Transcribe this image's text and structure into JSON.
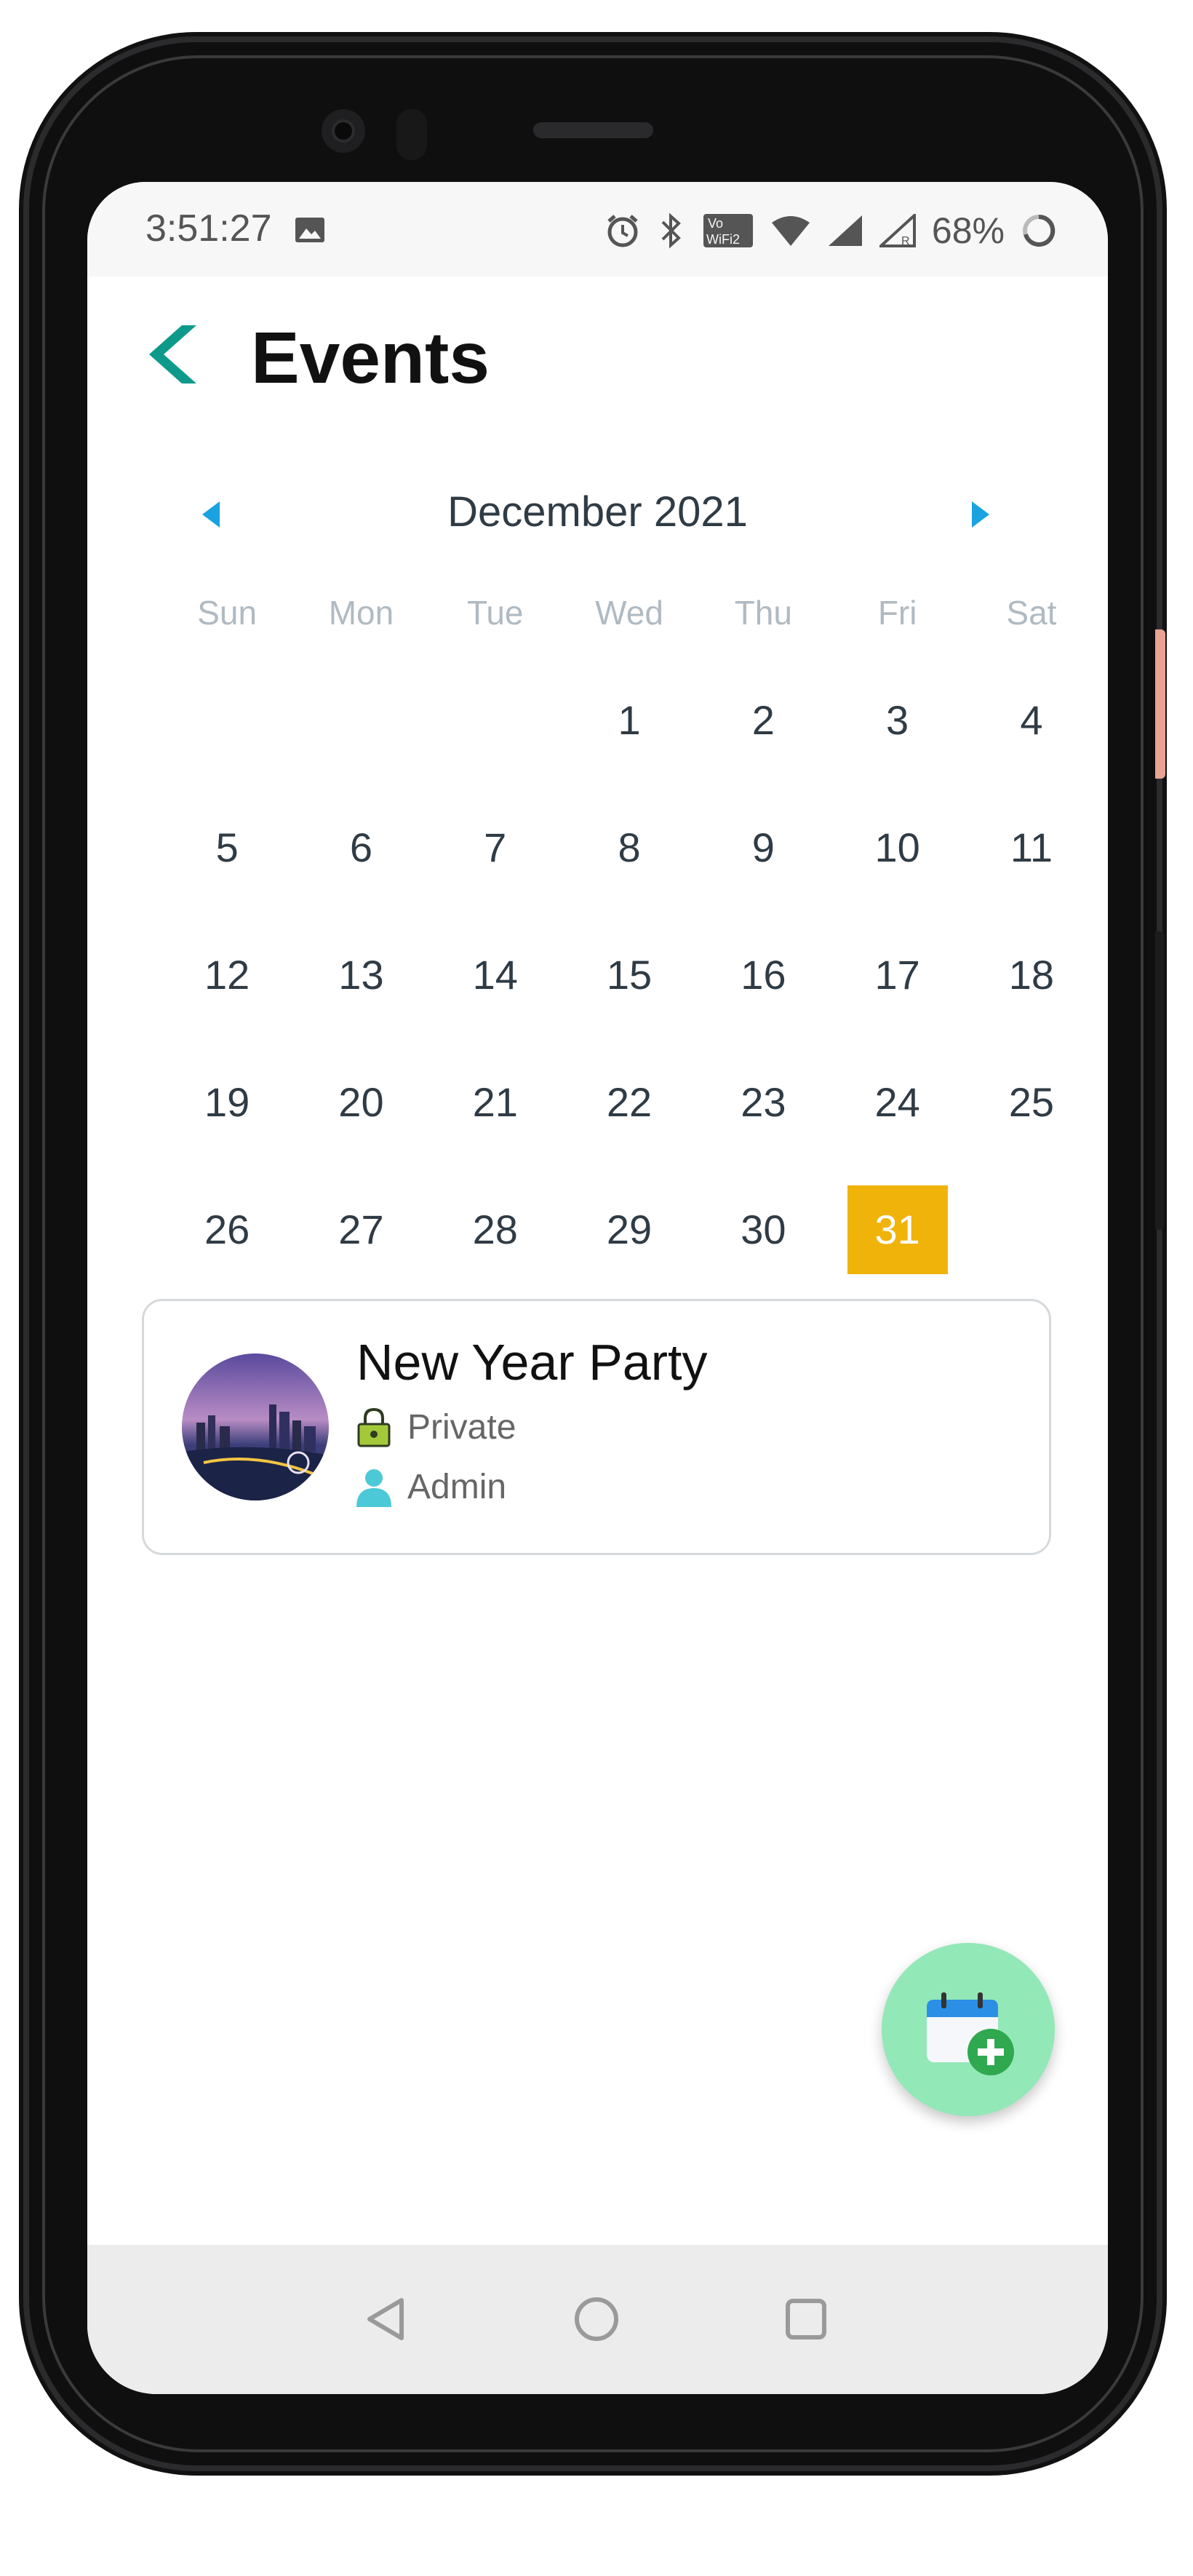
{
  "status_bar": {
    "time": "3:51:27",
    "battery": "68%",
    "icons": [
      "image-icon",
      "alarm-icon",
      "bluetooth-icon",
      "vowifi-icon",
      "wifi-icon",
      "signal-icon",
      "signal-r-icon",
      "battery-ring-icon"
    ]
  },
  "header": {
    "title": "Events",
    "back_icon": "chevron-left-icon"
  },
  "calendar": {
    "month_label": "December 2021",
    "prev_icon": "caret-left-icon",
    "next_icon": "caret-right-icon",
    "weekdays": [
      "Sun",
      "Mon",
      "Tue",
      "Wed",
      "Thu",
      "Fri",
      "Sat"
    ],
    "days": [
      "",
      "",
      "",
      "1",
      "2",
      "3",
      "4",
      "5",
      "6",
      "7",
      "8",
      "9",
      "10",
      "11",
      "12",
      "13",
      "14",
      "15",
      "16",
      "17",
      "18",
      "19",
      "20",
      "21",
      "22",
      "23",
      "24",
      "25",
      "26",
      "27",
      "28",
      "29",
      "30",
      "31",
      ""
    ],
    "selected_day": "31",
    "selected_color": "#f0b30a"
  },
  "event": {
    "name": "New Year Party",
    "privacy": "Private",
    "owner": "Admin",
    "thumb_icon": "city-night-photo"
  },
  "fab": {
    "icon": "calendar-add-icon",
    "color": "#93e8b7"
  },
  "system_nav": {
    "icons": [
      "back-triangle-icon",
      "home-circle-icon",
      "recents-square-icon"
    ]
  },
  "colors": {
    "accent": "#0e9a8a",
    "calendar_nav": "#1aa3e0"
  }
}
